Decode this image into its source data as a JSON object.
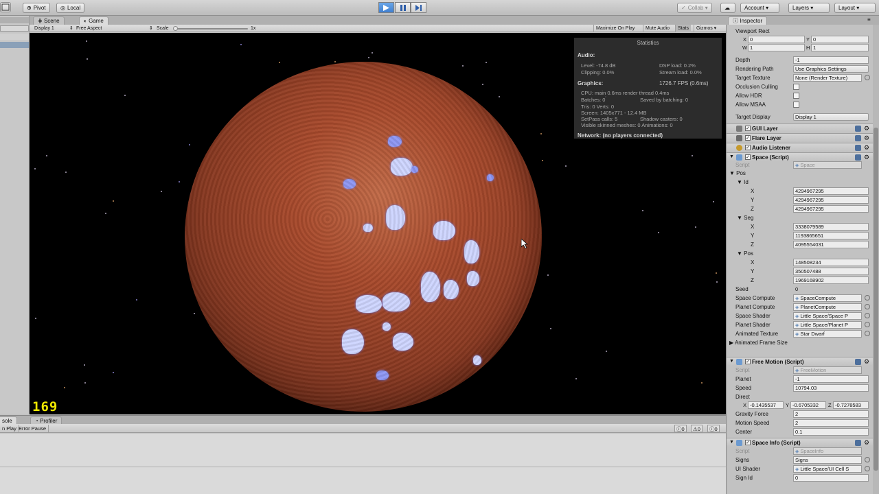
{
  "toolbar": {
    "pivot_label": "Pivot",
    "local_label": "Local",
    "collab_label": "Collab",
    "account_label": "Account",
    "layers_label": "Layers",
    "layout_label": "Layout"
  },
  "tabs": {
    "scene": "Scene",
    "game": "Game"
  },
  "gamebar": {
    "display": "Display 1",
    "aspect": "Free Aspect",
    "scale_label": "Scale",
    "scale_value": "1x",
    "scale_fraction": 0.0,
    "maximize": "Maximize On Play",
    "mute": "Mute Audio",
    "stats": "Stats",
    "gizmos": "Gizmos"
  },
  "stats": {
    "title": "Statistics",
    "audio_header": "Audio:",
    "level": "Level: -74.8 dB",
    "dsp": "DSP load: 0.2%",
    "clipping": "Clipping: 0.0%",
    "stream": "Stream load: 0.0%",
    "graphics_header": "Graphics:",
    "fps": "1726.7 FPS (0.6ms)",
    "cpu": "CPU: main 0.6ms  render thread 0.4ms",
    "batches": "Batches: 0",
    "saved": "Saved by batching: 0",
    "tris": "Tris: 0    Verts: 0",
    "screen": "Screen: 1405x771 - 12.4 MB",
    "setpass": "SetPass calls: 5",
    "shadow": "Shadow casters: 0",
    "skinned": "Visible skinned meshes: 0  Animations: 0",
    "network": "Network: (no players connected)"
  },
  "fps_overlay": "169",
  "console": {
    "tab_console": "sole",
    "tab_profiler": "Profiler",
    "clear_on_play": "n Play",
    "error_pause": "Error Pause",
    "count_log": "0",
    "count_warn": "0",
    "count_error": "0"
  },
  "inspector": {
    "tab": "Inspector",
    "viewport_rect": "Viewport Rect",
    "vr": {
      "x": "0",
      "y": "0",
      "w": "1",
      "h": "1"
    },
    "depth_label": "Depth",
    "depth": "-1",
    "rendering_path_label": "Rendering Path",
    "rendering_path": "Use Graphics Settings",
    "target_texture_label": "Target Texture",
    "target_texture": "None (Render Texture)",
    "occlusion_label": "Occlusion Culling",
    "hdr_label": "Allow HDR",
    "msaa_label": "Allow MSAA",
    "target_display_label": "Target Display",
    "target_display": "Display 1",
    "components": {
      "gui_layer": "GUI Layer",
      "flare_layer": "Flare Layer",
      "audio_listener": "Audio Listener",
      "space": "Space (Script)",
      "free_motion": "Free Motion (Script)",
      "space_info": "Space Info (Script)"
    },
    "space": {
      "script_label": "Script",
      "script": "Space",
      "pos_label": "Pos",
      "id_label": "Id",
      "id": {
        "x": "4294967295",
        "y": "4294967295",
        "z": "4294967295"
      },
      "seg_label": "Seg",
      "seg": {
        "x": "3338079589",
        "y": "1193865651",
        "z": "4095554031"
      },
      "pos2_label": "Pos",
      "pos": {
        "x": "148508234",
        "y": "350507488",
        "z": "1969168902"
      },
      "seed_label": "Seed",
      "seed": "0",
      "space_compute_label": "Space Compute",
      "space_compute": "SpaceCompute",
      "planet_compute_label": "Planet Compute",
      "planet_compute": "PlanetCompute",
      "space_shader_label": "Space Shader",
      "space_shader": "Little Space/Space P",
      "planet_shader_label": "Planet Shader",
      "planet_shader": "Little Space/Planet P",
      "animated_texture_label": "Animated Texture",
      "animated_texture": "Star Dwarf",
      "animated_frame_size_label": "Animated Frame Size"
    },
    "free_motion": {
      "script_label": "Script",
      "script": "FreeMotion",
      "planet_label": "Planet",
      "planet": "-1",
      "speed_label": "Speed",
      "speed": "10794.03",
      "direct_label": "Direct",
      "direct": {
        "x": "-0.1435537",
        "y": "-0.6705332",
        "z": "-0.7278583"
      },
      "gravity_label": "Gravity Force",
      "gravity": "2",
      "motion_speed_label": "Motion Speed",
      "motion_speed": "2",
      "center_label": "Center",
      "center": "0.1"
    },
    "space_info": {
      "script_label": "Script",
      "script": "SpaceInfo",
      "signs_label": "Signs",
      "signs": "Signs",
      "ui_shader_label": "UI Shader",
      "ui_shader": "Little Space/UI Cell S",
      "sign_id_label": "Sign Id",
      "sign_id": "0"
    }
  }
}
